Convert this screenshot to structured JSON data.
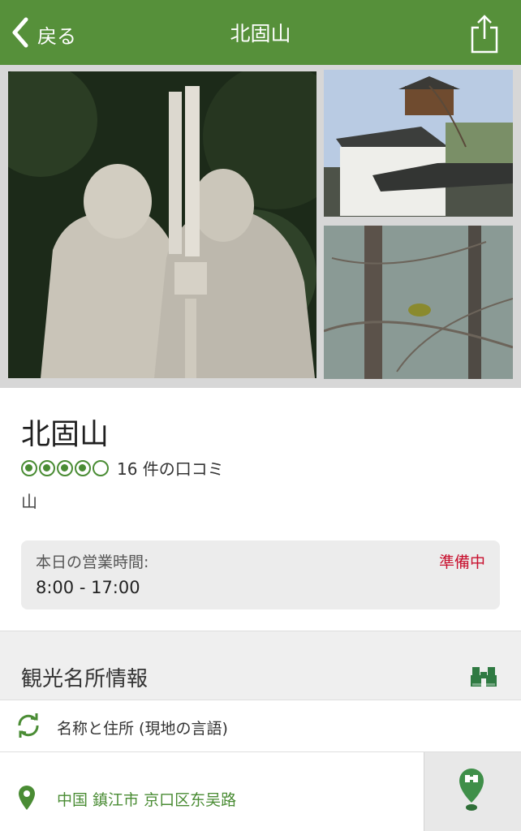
{
  "nav": {
    "back_label": "戻る",
    "title": "北固山"
  },
  "attraction": {
    "name": "北固山",
    "rating": 4,
    "rating_max": 5,
    "review_count_text": "16 件の口コミ",
    "category": "山"
  },
  "hours": {
    "label": "本日の営業時間:",
    "status": "準備中",
    "time": "8:00 - 17:00"
  },
  "section": {
    "title": "観光名所情報"
  },
  "info": {
    "name_address_label": "名称と住所 (現地の言語)",
    "address": "中国 鎮江市 京口区东吴路"
  },
  "colors": {
    "brand_green": "#56903a",
    "status_red": "#c8102e"
  },
  "icons": [
    "chevron-left-icon",
    "share-icon",
    "binoculars-icon",
    "refresh-icon",
    "location-pin-icon",
    "map-pin-icon"
  ]
}
